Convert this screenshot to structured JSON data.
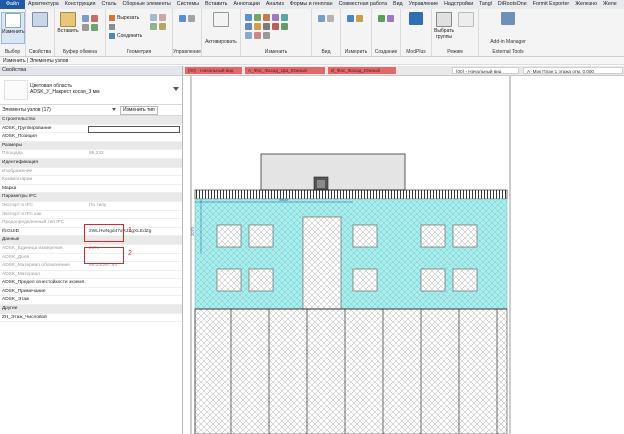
{
  "menubar": {
    "tabs": [
      "Файл",
      "Архитектура",
      "Конструкция",
      "Сталь",
      "Сборные элементы",
      "Системы",
      "Вставить",
      "Аннотации",
      "Анализ",
      "Формы и генплан",
      "Совместная работа",
      "Вид",
      "Управление",
      "Надстройки",
      "Tangl",
      "DiRootsOne",
      "Formit Exporter",
      "Железно",
      "Желе"
    ]
  },
  "ribbon": {
    "modify_label": "Изменить",
    "select_label": "Выбор",
    "properties_label": "Свойства",
    "clipboard_label": "Буфер обмена",
    "insert_label": "Вставить",
    "cut_label": "Вырезать",
    "join_label": "Соединить",
    "geometry_label": "Геометрия",
    "control_label": "Управление",
    "activate_label": "Активировать",
    "modify_group_label": "Изменить",
    "view_label": "Вид",
    "measure_label": "Измерить",
    "create_label": "Создание",
    "modplus_label": "ModPlus",
    "select_groups_label": "Выбрать группы",
    "mode_label": "Режим",
    "addin_manager_label": "Add-in Manager",
    "external_tools_label": "External Tools"
  },
  "optbar": {
    "text": "Изменить | Элементы узлов"
  },
  "properties": {
    "title": "Свойства",
    "type_name_line1": "Цветовая область",
    "type_name_line2": "ADSK_У_Накрест косая_3 мм",
    "filter": "Элементы узлов (17)",
    "edit_type": "Изменить тип",
    "rows": [
      {
        "name": "Строительство",
        "value": "",
        "kind": "hdr"
      },
      {
        "name": "ADSK_Группирование",
        "value": "",
        "kind": "box"
      },
      {
        "name": "ADSK_Позиция",
        "value": "",
        "kind": "normal"
      },
      {
        "name": "Размеры",
        "value": "",
        "kind": "hdr"
      },
      {
        "name": "Площадь",
        "value": "89,232",
        "kind": "grey"
      },
      {
        "name": "Идентификация",
        "value": "",
        "kind": "hdr"
      },
      {
        "name": "Изображение",
        "value": "",
        "kind": "grey"
      },
      {
        "name": "Комментарии",
        "value": "",
        "kind": "grey"
      },
      {
        "name": "Марка",
        "value": "",
        "kind": "normal"
      },
      {
        "name": "Параметры IFC",
        "value": "",
        "kind": "hdr"
      },
      {
        "name": "Экспорт в IFC",
        "value": "По типу",
        "kind": "grey"
      },
      {
        "name": "Экспорт в IFC как",
        "value": "",
        "kind": "grey"
      },
      {
        "name": "Предопределенный тип IFC",
        "value": "",
        "kind": "grey"
      },
      {
        "name": "IfcGUID",
        "value": "2WLHwNgd47xRJXgXLEdZg",
        "kind": "normal"
      },
      {
        "name": "Данные",
        "value": "",
        "kind": "hdr"
      },
      {
        "name": "ADSK_Единица измерения",
        "value": "24%",
        "kind": "grey"
      },
      {
        "name": "ADSK_Доля",
        "value": "",
        "kind": "grey"
      },
      {
        "name": "ADSK_Материал обозначение",
        "value": "89,23/267,94",
        "kind": "grey"
      },
      {
        "name": "ADSK_Материал",
        "value": "",
        "kind": "grey"
      },
      {
        "name": "ADSK_Предел огнестойкости экземп…",
        "value": "",
        "kind": "normal"
      },
      {
        "name": "ADSK_Примечание",
        "value": "",
        "kind": "normal"
      },
      {
        "name": "ADSK_Этаж",
        "value": "",
        "kind": "normal"
      },
      {
        "name": "Другие",
        "value": "",
        "kind": "hdr"
      },
      {
        "name": "ZH_Этаж_Числовой",
        "value": "",
        "kind": "normal"
      }
    ],
    "marker1": "1",
    "marker2": "2"
  },
  "viewtabs": [
    {
      "label": "{00} - Начальный вид",
      "kind": "red"
    },
    {
      "label": "А_Фас_Фасад_ЦШ_Южный",
      "kind": "red"
    },
    {
      "label": "И_Фас_Фасад_Южный",
      "kind": "red"
    },
    {
      "label": "{00} - Начальный вид",
      "kind": "plain"
    },
    {
      "label": "А_Мрк План 1 этажа отм. 0,000",
      "kind": "plain"
    }
  ],
  "canvas": {
    "dim_top": "9800",
    "dim_left": "2070",
    "fill_color": "#a6efef",
    "accent_color": "#1f5aa6",
    "red_color": "#d7282f"
  }
}
